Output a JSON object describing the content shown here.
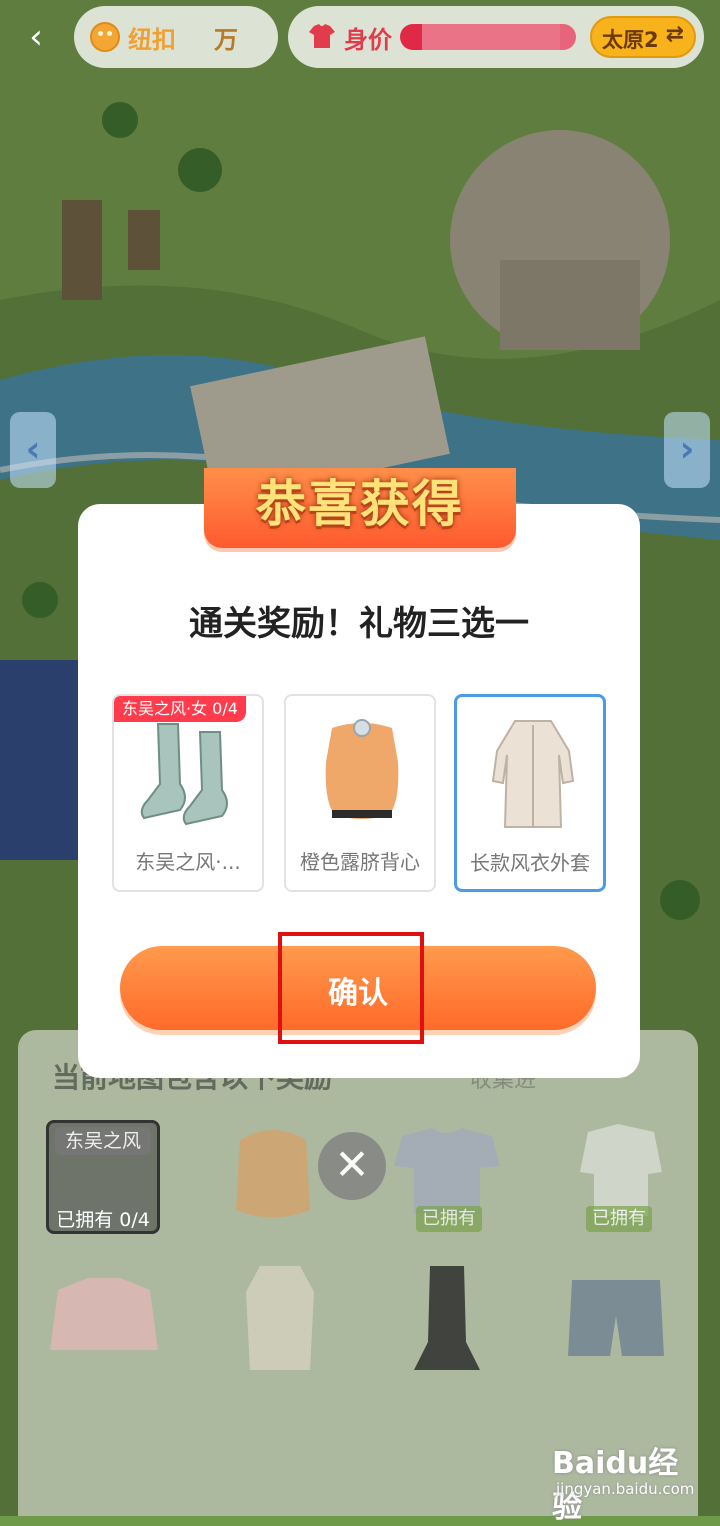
{
  "topbar": {
    "back_icon": "chevron-left-icon",
    "buttons_label": "纽扣",
    "buttons_value": "万",
    "worth_label": "身价",
    "worth_progress": 0.85,
    "city_label": "太原2",
    "city_swap_icon": "swap-icon"
  },
  "modal": {
    "banner_title": "恭喜获得",
    "subtitle": "通关奖励！礼物三选一",
    "options": [
      {
        "tag": "东吴之风·女 0/4",
        "name": "东吴之风·...",
        "icon": "boots-icon",
        "selected": false
      },
      {
        "tag": "",
        "name": "橙色露脐背心",
        "icon": "crop-top-icon",
        "selected": false
      },
      {
        "tag": "",
        "name": "长款风衣外套",
        "icon": "trench-coat-icon",
        "selected": true
      }
    ],
    "confirm_label": "确认"
  },
  "bottom": {
    "title": "当前地图包含以下奖励",
    "more": "收集进",
    "set_name": "东吴之风",
    "set_owned": "已拥有 0/4",
    "owned_badge": "已拥有"
  },
  "close_icon": "close-icon",
  "watermark": {
    "brand": "Baidu经验",
    "url": "jingyan.baidu.com"
  },
  "colors": {
    "accent": "#ff6a2a",
    "selected_border": "#4b9be8",
    "tag_red": "#ff3b4c",
    "highlight": "#e01010"
  }
}
